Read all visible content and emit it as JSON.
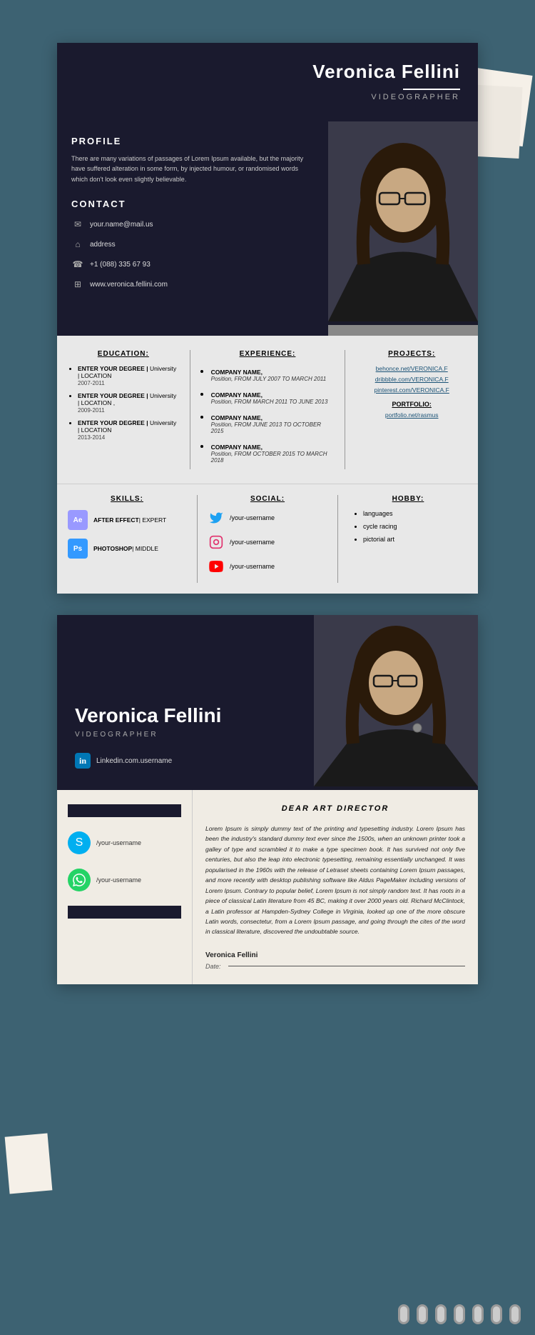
{
  "page": {
    "bg_color": "#3d6272"
  },
  "resume1": {
    "header": {
      "name": "Veronica Fellini",
      "title": "VIDEOGRAPHER"
    },
    "profile": {
      "heading": "PROFILE",
      "text": "There are many variations of passages of Lorem Ipsum available, but the majority have suffered alteration in some form, by injected humour, or randomised words which don't look even slightly believable."
    },
    "contact": {
      "heading": "CONTACT",
      "items": [
        {
          "icon": "email-icon",
          "text": "your.name@mail.us"
        },
        {
          "icon": "home-icon",
          "text": "address"
        },
        {
          "icon": "phone-icon",
          "text": "+1 (088) 335 67 93"
        },
        {
          "icon": "web-icon",
          "text": "www.veronica.fellini.com"
        }
      ]
    },
    "education": {
      "heading": "EDUCATION:",
      "items": [
        {
          "degree": "ENTER YOUR DEGREE |",
          "detail": "University | LOCATION",
          "dates": "2007-2011"
        },
        {
          "degree": "ENTER YOUR DEGREE |",
          "detail": "University | LOCATION ,",
          "dates": "2009-2011"
        },
        {
          "degree": "ENTER YOUR DEGREE |",
          "detail": "University | LOCATION",
          "dates": "2013-2014"
        }
      ]
    },
    "experience": {
      "heading": "EXPERIENCE:",
      "items": [
        {
          "company": "COMPANY NAME,",
          "role": "Position,",
          "dates": "FROM JULY 2007 TO MARCH 2011"
        },
        {
          "company": "COMPANY NAME,",
          "role": "Position,",
          "dates": "FROM MARCH 2011 TO JUNE 2013"
        },
        {
          "company": "COMPANY NAME,",
          "role": "Position,",
          "dates": "FROM JUNE 2013 TO OCTOBER 2015"
        },
        {
          "company": "COMPANY NAME,",
          "role": "Position,",
          "dates": "FROM OCTOBER 2015 TO MARCH 2018"
        }
      ]
    },
    "projects": {
      "heading": "PROJECTS:",
      "links": [
        "behonce.net/VERONICA.F",
        "dribbble.com/VERONICA.F",
        "pinterest.com/VERONICA.F"
      ],
      "portfolio_heading": "PORTFOLIO:",
      "portfolio_link": "portfolio.net/rasmus"
    },
    "skills": {
      "heading": "SKILLS:",
      "items": [
        {
          "name": "AFTER EFFECT",
          "level": "| EXPERT"
        },
        {
          "name": "PHOTOSHOP",
          "level": "| MIDDLE"
        }
      ]
    },
    "social": {
      "heading": "SOCIAL:",
      "items": [
        {
          "platform": "twitter",
          "username": "/your-username"
        },
        {
          "platform": "instagram",
          "username": "/your-username"
        },
        {
          "platform": "youtube",
          "username": "/your-username"
        }
      ]
    },
    "hobby": {
      "heading": "HOBBY:",
      "items": [
        "languages",
        "cycle racing",
        "pictorial art"
      ]
    }
  },
  "resume2": {
    "header": {
      "name": "Veronica Fellini",
      "title": "VIDEOGRAPHER",
      "linkedin": "Linkedin.com.username"
    },
    "letter": {
      "heading": "DEAR ART DIRECTOR",
      "body": "Lorem Ipsum is simply dummy text of the printing and typesetting industry. Lorem Ipsum has been the industry's standard dummy text ever since the 1500s, when an unknown printer took a galley of type and scrambled it to make a type specimen book. It has survived not only five centuries, but also the leap into electronic typesetting, remaining essentially unchanged. It was popularised in the 1960s with the release of Letraset sheets containing Lorem Ipsum passages, and more recently with desktop publishing software like Aldus PageMaker including versions of Lorem Ipsum. Contrary to popular belief, Lorem Ipsum is not simply random text. It has roots in a piece of classical Latin literature from 45 BC, making it over 2000 years old. Richard McClintock, a Latin professor at Hampden-Sydney College in Virginia, looked up one of the more obscure Latin words, consectetur, from a Lorem Ipsum passage, and going through the cites of the word in classical literature, discovered the undoubtable source.",
      "social_items": [
        {
          "platform": "skype",
          "username": "/your-username"
        },
        {
          "platform": "whatsapp",
          "username": "/your-username"
        }
      ],
      "signature": "Veronica Fellini",
      "date_label": "Date:"
    }
  }
}
